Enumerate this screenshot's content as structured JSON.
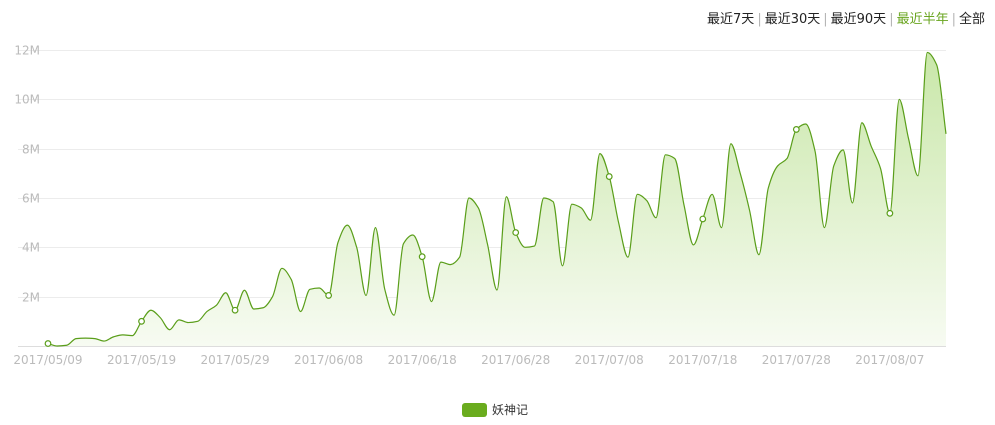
{
  "range_tabs": {
    "items": [
      "最近7天",
      "最近30天",
      "最近90天",
      "最近半年",
      "全部"
    ],
    "active_index": 3
  },
  "colors": {
    "series_line": "#5a9e1a",
    "area_top": "#c9e7a9",
    "area_bottom": "#f7fbf2",
    "active_tab": "#6aa520",
    "grid": "#ececec",
    "axis_text": "#bbbbbb",
    "legend_swatch": "#6aac1e"
  },
  "legend": {
    "label": "妖神记"
  },
  "chart_data": {
    "type": "area",
    "title": "",
    "xlabel": "",
    "ylabel": "",
    "x_range": [
      "2017-05-09",
      "2017-08-13"
    ],
    "ylim": [
      0,
      12000000
    ],
    "y_ticks": [
      {
        "value": 2000000,
        "label": "2M"
      },
      {
        "value": 4000000,
        "label": "4M"
      },
      {
        "value": 6000000,
        "label": "6M"
      },
      {
        "value": 8000000,
        "label": "8M"
      },
      {
        "value": 10000000,
        "label": "10M"
      },
      {
        "value": 12000000,
        "label": "12M"
      }
    ],
    "x_ticks": [
      "2017/05/09",
      "2017/05/19",
      "2017/05/29",
      "2017/06/08",
      "2017/06/18",
      "2017/06/28",
      "2017/07/08",
      "2017/07/18",
      "2017/07/28",
      "2017/08/07"
    ],
    "grid": true,
    "legend_position": "bottom-center",
    "series": [
      {
        "name": "妖神记",
        "marker_every": 10,
        "points": [
          [
            "2017-05-09",
            100000
          ],
          [
            "2017-05-10",
            0
          ],
          [
            "2017-05-11",
            30000
          ],
          [
            "2017-05-12",
            300000
          ],
          [
            "2017-05-13",
            320000
          ],
          [
            "2017-05-14",
            300000
          ],
          [
            "2017-05-15",
            200000
          ],
          [
            "2017-05-16",
            370000
          ],
          [
            "2017-05-17",
            450000
          ],
          [
            "2017-05-18",
            420000
          ],
          [
            "2017-05-19",
            1000000
          ],
          [
            "2017-05-20",
            1450000
          ],
          [
            "2017-05-21",
            1150000
          ],
          [
            "2017-05-22",
            660000
          ],
          [
            "2017-05-23",
            1060000
          ],
          [
            "2017-05-24",
            950000
          ],
          [
            "2017-05-25",
            1000000
          ],
          [
            "2017-05-26",
            1400000
          ],
          [
            "2017-05-27",
            1650000
          ],
          [
            "2017-05-28",
            2160000
          ],
          [
            "2017-05-29",
            1450000
          ],
          [
            "2017-05-30",
            2260000
          ],
          [
            "2017-05-31",
            1500000
          ],
          [
            "2017-06-01",
            1550000
          ],
          [
            "2017-06-02",
            2000000
          ],
          [
            "2017-06-03",
            3150000
          ],
          [
            "2017-06-04",
            2700000
          ],
          [
            "2017-06-05",
            1400000
          ],
          [
            "2017-06-06",
            2300000
          ],
          [
            "2017-06-07",
            2350000
          ],
          [
            "2017-06-08",
            2050000
          ],
          [
            "2017-06-09",
            4200000
          ],
          [
            "2017-06-10",
            4900000
          ],
          [
            "2017-06-11",
            4000000
          ],
          [
            "2017-06-12",
            2050000
          ],
          [
            "2017-06-13",
            4800000
          ],
          [
            "2017-06-14",
            2300000
          ],
          [
            "2017-06-15",
            1250000
          ],
          [
            "2017-06-16",
            4150000
          ],
          [
            "2017-06-17",
            4500000
          ],
          [
            "2017-06-18",
            3620000
          ],
          [
            "2017-06-19",
            1800000
          ],
          [
            "2017-06-20",
            3400000
          ],
          [
            "2017-06-21",
            3300000
          ],
          [
            "2017-06-22",
            3600000
          ],
          [
            "2017-06-23",
            6000000
          ],
          [
            "2017-06-24",
            5600000
          ],
          [
            "2017-06-25",
            4100000
          ],
          [
            "2017-06-26",
            2270000
          ],
          [
            "2017-06-27",
            6050000
          ],
          [
            "2017-06-28",
            4600000
          ],
          [
            "2017-06-29",
            4000000
          ],
          [
            "2017-06-30",
            4050000
          ],
          [
            "2017-07-01",
            6000000
          ],
          [
            "2017-07-02",
            5850000
          ],
          [
            "2017-07-03",
            3250000
          ],
          [
            "2017-07-04",
            5750000
          ],
          [
            "2017-07-05",
            5600000
          ],
          [
            "2017-07-06",
            5100000
          ],
          [
            "2017-07-07",
            7800000
          ],
          [
            "2017-07-08",
            6870000
          ],
          [
            "2017-07-09",
            5000000
          ],
          [
            "2017-07-10",
            3600000
          ],
          [
            "2017-07-11",
            6150000
          ],
          [
            "2017-07-12",
            5900000
          ],
          [
            "2017-07-13",
            5200000
          ],
          [
            "2017-07-14",
            7750000
          ],
          [
            "2017-07-15",
            7600000
          ],
          [
            "2017-07-16",
            5700000
          ],
          [
            "2017-07-17",
            4100000
          ],
          [
            "2017-07-18",
            5150000
          ],
          [
            "2017-07-19",
            6150000
          ],
          [
            "2017-07-20",
            4800000
          ],
          [
            "2017-07-21",
            8200000
          ],
          [
            "2017-07-22",
            7000000
          ],
          [
            "2017-07-23",
            5500000
          ],
          [
            "2017-07-24",
            3700000
          ],
          [
            "2017-07-25",
            6400000
          ],
          [
            "2017-07-26",
            7300000
          ],
          [
            "2017-07-27",
            7600000
          ],
          [
            "2017-07-28",
            8780000
          ],
          [
            "2017-07-29",
            9000000
          ],
          [
            "2017-07-30",
            7900000
          ],
          [
            "2017-07-31",
            4800000
          ],
          [
            "2017-08-01",
            7300000
          ],
          [
            "2017-08-02",
            7950000
          ],
          [
            "2017-08-03",
            5800000
          ],
          [
            "2017-08-04",
            9050000
          ],
          [
            "2017-08-05",
            8100000
          ],
          [
            "2017-08-06",
            7200000
          ],
          [
            "2017-08-07",
            5380000
          ],
          [
            "2017-08-08",
            10000000
          ],
          [
            "2017-08-09",
            8400000
          ],
          [
            "2017-08-10",
            6900000
          ],
          [
            "2017-08-11",
            11900000
          ],
          [
            "2017-08-12",
            11400000
          ],
          [
            "2017-08-13",
            8600000
          ]
        ]
      }
    ]
  }
}
